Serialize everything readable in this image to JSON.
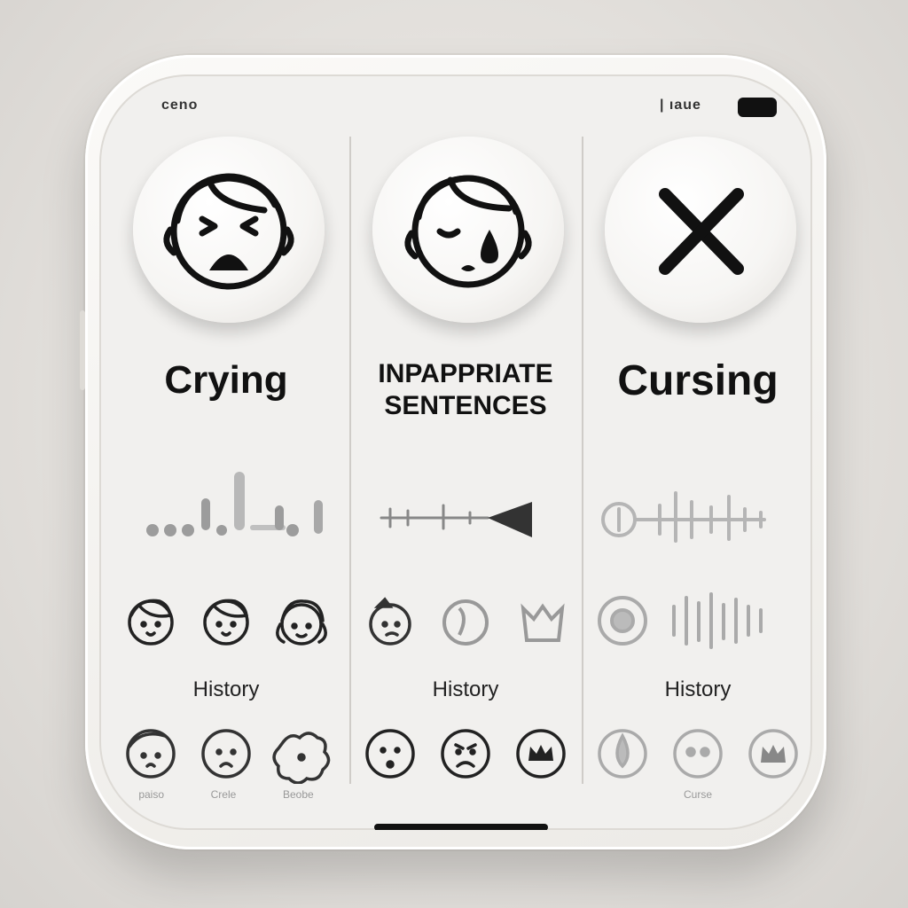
{
  "status": {
    "left_text": "ceno",
    "right_text": "| ıaue"
  },
  "columns": [
    {
      "title": "Crying",
      "history_label": "History",
      "tiny_labels": [
        "paiso",
        "Crele",
        "Beobe"
      ]
    },
    {
      "title_line1": "INPAPPRIATE",
      "title_line2": "SENTENCES",
      "history_label": "History"
    },
    {
      "title": "Cursing",
      "history_label": "History",
      "tiny_labels": [
        "Curse"
      ]
    }
  ],
  "icons": {
    "col1_main": "crying-face-icon",
    "col2_main": "tear-face-icon",
    "col3_main": "x-mark-icon"
  },
  "colors": {
    "ink": "#111111",
    "panel": "#f1f0ee",
    "waveform_gray": "#9a9a9a"
  }
}
